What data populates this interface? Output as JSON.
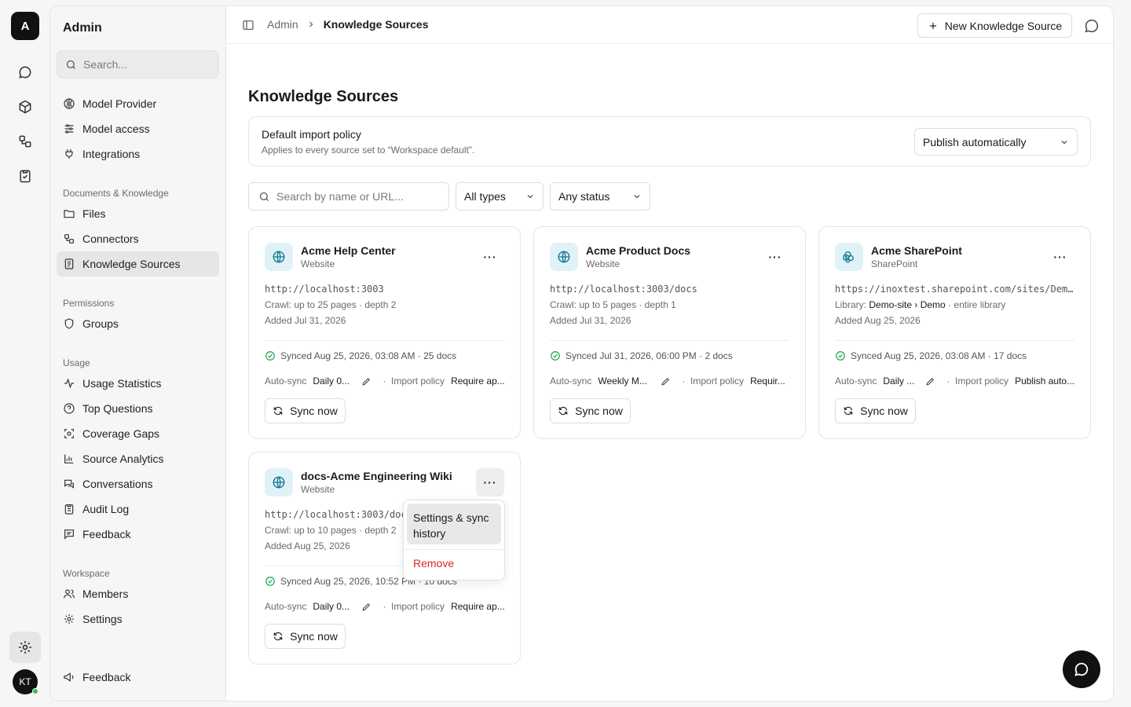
{
  "rail": {
    "workspace_initial": "A",
    "avatar_initials": "KT"
  },
  "sidebar": {
    "title": "Admin",
    "search_placeholder": "Search...",
    "top_items": [
      "Model Provider",
      "Model access",
      "Integrations"
    ],
    "sections": [
      {
        "label": "Documents & Knowledge",
        "items": [
          "Files",
          "Connectors",
          "Knowledge Sources"
        ]
      },
      {
        "label": "Permissions",
        "items": [
          "Groups"
        ]
      },
      {
        "label": "Usage",
        "items": [
          "Usage Statistics",
          "Top Questions",
          "Coverage Gaps",
          "Source Analytics",
          "Conversations",
          "Audit Log",
          "Feedback"
        ]
      },
      {
        "label": "Workspace",
        "items": [
          "Members",
          "Settings"
        ]
      }
    ],
    "footer_item": "Feedback"
  },
  "header": {
    "breadcrumb_parent": "Admin",
    "breadcrumb_current": "Knowledge Sources",
    "new_button": "New Knowledge Source"
  },
  "page": {
    "title": "Knowledge Sources",
    "policy": {
      "title": "Default import policy",
      "subtitle": "Applies to every source set to “Workspace default”.",
      "value": "Publish automatically"
    },
    "filters": {
      "search_placeholder": "Search by name or URL...",
      "type": "All types",
      "status": "Any status"
    }
  },
  "cards": [
    {
      "name": "Acme Help Center",
      "type": "Website",
      "url": "http://localhost:3003",
      "detail": "Crawl: up to 25 pages · depth 2",
      "added": "Added Jul 31, 2026",
      "sync": "Synced Aug 25, 2026, 03:08 AM · 25 docs",
      "auto_label": "Auto-sync",
      "auto_value": "Daily 0...",
      "policy_label": "Import policy",
      "policy_value": "Require ap...",
      "sync_btn": "Sync now"
    },
    {
      "name": "Acme Product Docs",
      "type": "Website",
      "url": "http://localhost:3003/docs",
      "detail": "Crawl: up to 5 pages · depth 1",
      "added": "Added Jul 31, 2026",
      "sync": "Synced Jul 31, 2026, 06:00 PM · 2 docs",
      "auto_label": "Auto-sync",
      "auto_value": "Weekly M...",
      "policy_label": "Import policy",
      "policy_value": "Requir...",
      "sync_btn": "Sync now"
    },
    {
      "name": "Acme SharePoint",
      "type": "SharePoint",
      "url": "https://inoxtest.sharepoint.com/sites/Dem...",
      "detail_prefix": "Library:",
      "detail_strong": "Demo-site › Demo",
      "detail_suffix": "· entire library",
      "added": "Added Aug 25, 2026",
      "sync": "Synced Aug 25, 2026, 03:08 AM · 17 docs",
      "auto_label": "Auto-sync",
      "auto_value": "Daily ...",
      "policy_label": "Import policy",
      "policy_value": "Publish auto...",
      "sync_btn": "Sync now"
    },
    {
      "name": "docs-Acme Engineering Wiki",
      "type": "Website",
      "url": "http://localhost:3003/docs",
      "detail": "Crawl: up to 10 pages · depth 2",
      "added": "Added Aug 25, 2026",
      "sync": "Synced Aug 25, 2026, 10:52 PM · 10 docs",
      "auto_label": "Auto-sync",
      "auto_value": "Daily 0...",
      "policy_label": "Import policy",
      "policy_value": "Require ap...",
      "sync_btn": "Sync now"
    }
  ],
  "menu": {
    "item1": "Settings & sync history",
    "item2": "Remove"
  },
  "colors": {
    "accent": "#111111",
    "danger": "#dc2626",
    "success": "#16a34a",
    "icon_bg": "#e0f2f7",
    "icon_fg": "#0e7490"
  }
}
